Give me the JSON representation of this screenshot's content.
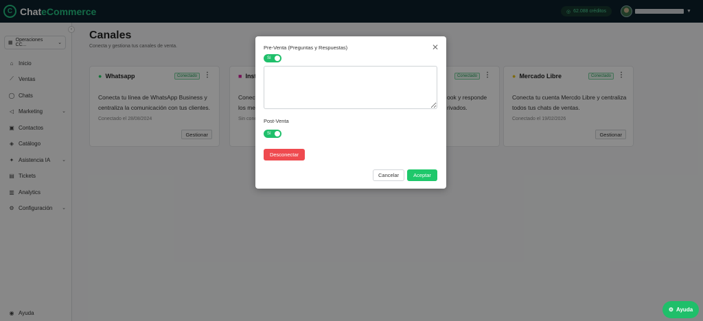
{
  "app": {
    "brand_prefix": "Chat",
    "brand_suffix": "eCommerce",
    "logo_letter": "C",
    "credits": "62.088 créditos",
    "accent": "#26c281",
    "topbar_color": "#0b1f2a"
  },
  "sidebar": {
    "workspace": "Operaciones CC...",
    "items": [
      {
        "label": "Inicio",
        "icon": "home-icon"
      },
      {
        "label": "Ventas",
        "icon": "chart-icon"
      },
      {
        "label": "Chats",
        "icon": "chat-icon"
      },
      {
        "label": "Marketing",
        "icon": "megaphone-icon"
      },
      {
        "label": "Contactos",
        "icon": "contacts-icon"
      },
      {
        "label": "Catálogo",
        "icon": "tag-icon"
      },
      {
        "label": "Asistencia IA",
        "icon": "sparkle-icon"
      },
      {
        "label": "Tickets",
        "icon": "ticket-icon"
      },
      {
        "label": "Analytics",
        "icon": "bar-chart-icon"
      },
      {
        "label": "Configuración",
        "icon": "gear-icon"
      }
    ],
    "help": "Ayuda"
  },
  "main": {
    "title": "Canales",
    "subtitle": "Conecta y gestiona tus canales de venta.",
    "cards": [
      {
        "name": "Whatsapp",
        "status": "Conectado",
        "desc_line1": "Conecta tu línea de WhatsApp Business y",
        "desc_line2": "centraliza la comunicación con tus clientes.",
        "date": "Conectado el 28/08/2024",
        "button": "Gestionar"
      },
      {
        "name": "Inst",
        "desc_line1": "Conecta",
        "desc_line2": "los men",
        "date": "Sin cone"
      },
      {
        "status": "Conectado",
        "desc_line1": "ook y responde",
        "desc_line2": "rivados."
      },
      {
        "name": "Mercado Libre",
        "status": "Conectado",
        "desc_line1": "Conecta tu cuenta Mercdo Libre y centraliza",
        "desc_line2": "todos tus chats de ventas.",
        "date": "Conectado el 19/02/2026",
        "button": "Gestionar"
      }
    ]
  },
  "modal": {
    "preventa_label": "Pre-Venta (Preguntas y Respuestas)",
    "preventa_toggle": "Sí",
    "preventa_text": "",
    "postventa_label": "Post-Venta",
    "postventa_toggle": "Sí",
    "disconnect": "Desconectar",
    "cancel": "Cancelar",
    "accept": "Aceptar"
  },
  "help_button": "Ayuda"
}
